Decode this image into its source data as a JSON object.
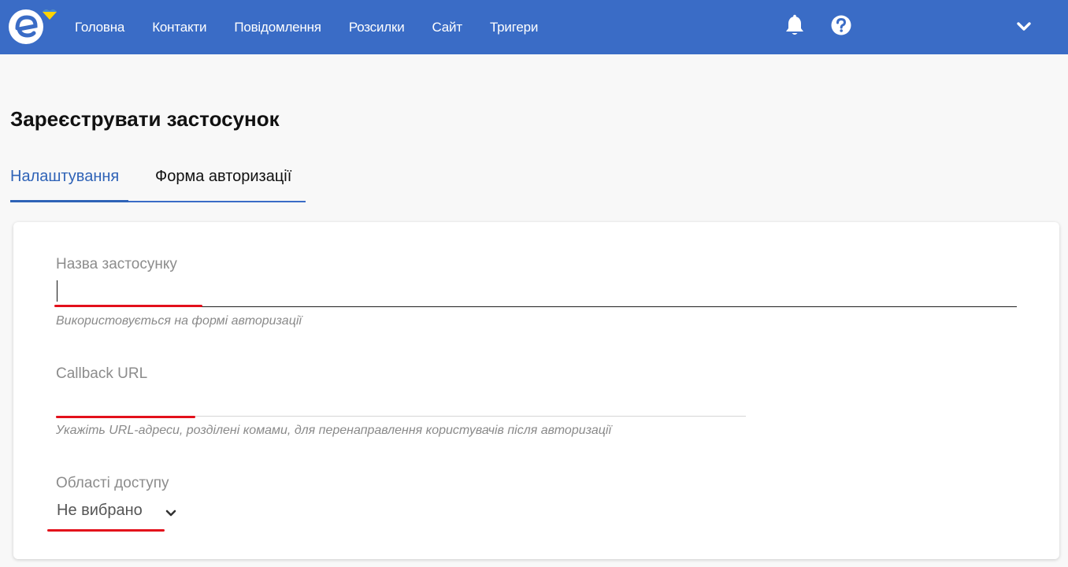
{
  "nav": {
    "items": [
      {
        "label": "Головна"
      },
      {
        "label": "Контакти"
      },
      {
        "label": "Повідомлення"
      },
      {
        "label": "Розсилки"
      },
      {
        "label": "Сайт"
      },
      {
        "label": "Тригери"
      }
    ],
    "icons": {
      "bell": "bell-icon",
      "help": "question-circle-icon",
      "menu": "chevron-down-icon"
    }
  },
  "colors": {
    "accent": "#3a6cc6",
    "underline_mark": "#e3101b"
  },
  "page": {
    "title": "Зареєструвати застосунок"
  },
  "tabs": [
    {
      "label": "Налаштування",
      "active": true
    },
    {
      "label": "Форма авторизації",
      "active": false
    }
  ],
  "form": {
    "app_name": {
      "label": "Назва застосунку",
      "value": "",
      "hint": "Використовується на формі авторизації"
    },
    "callback_url": {
      "label": "Callback URL",
      "value": "",
      "hint": "Укажіть URL-адреси, розділені комами, для перенаправлення користувачів після авторизації"
    },
    "scopes": {
      "label": "Області доступу",
      "selected": "Не вибрано"
    }
  }
}
